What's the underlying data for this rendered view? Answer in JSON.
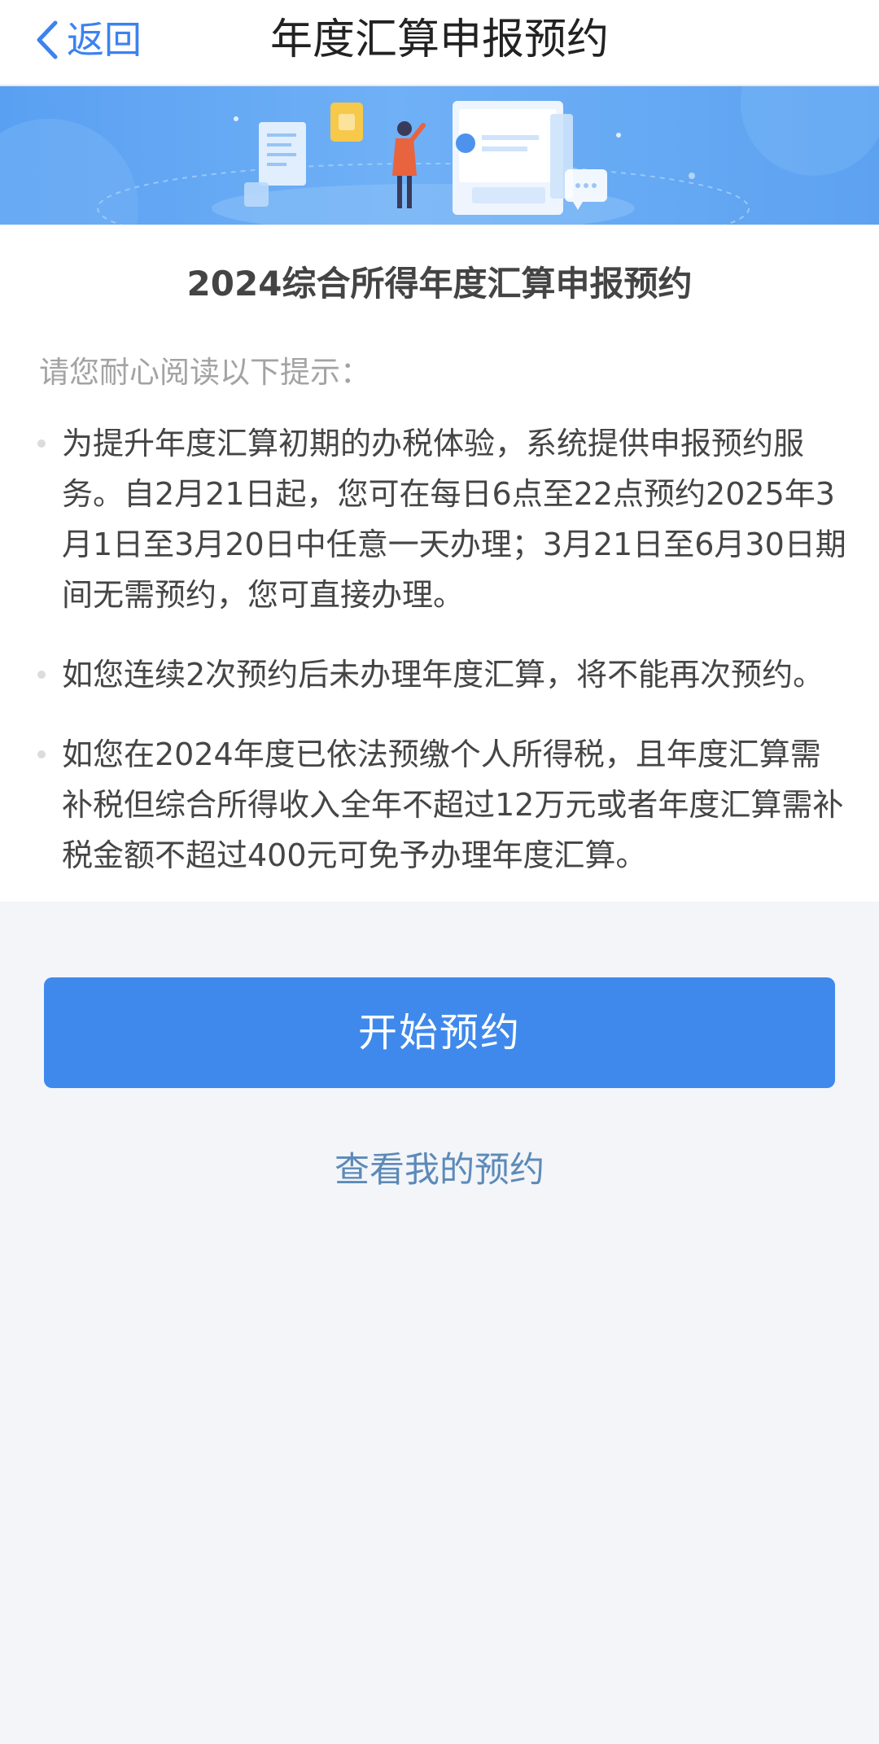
{
  "navbar": {
    "back_label": "返回",
    "title": "年度汇算申报预约"
  },
  "banner": {
    "illustration": "person-with-documents-illustration",
    "colors": {
      "background": "#5aa0f2",
      "accent_yellow": "#f6c94a"
    }
  },
  "content": {
    "section_title": "2024综合所得年度汇算申报预约",
    "hint": "请您耐心阅读以下提示：",
    "notices": [
      "为提升年度汇算初期的办税体验，系统提供申报预约服务。自2月21日起，您可在每日6点至22点预约2025年3月1日至3月20日中任意一天办理；3月21日至6月30日期间无需预约，您可直接办理。",
      "如您连续2次预约后未办理年度汇算，将不能再次预约。",
      "如您在2024年度已依法预缴个人所得税，且年度汇算需补税但综合所得收入全年不超过12万元或者年度汇算需补税金额不超过400元可免予办理年度汇算。"
    ]
  },
  "actions": {
    "start_label": "开始预约",
    "view_label": "查看我的预约"
  },
  "colors": {
    "primary": "#4089ec",
    "link": "#5c8ab8",
    "page_background": "#f3f5f9"
  }
}
